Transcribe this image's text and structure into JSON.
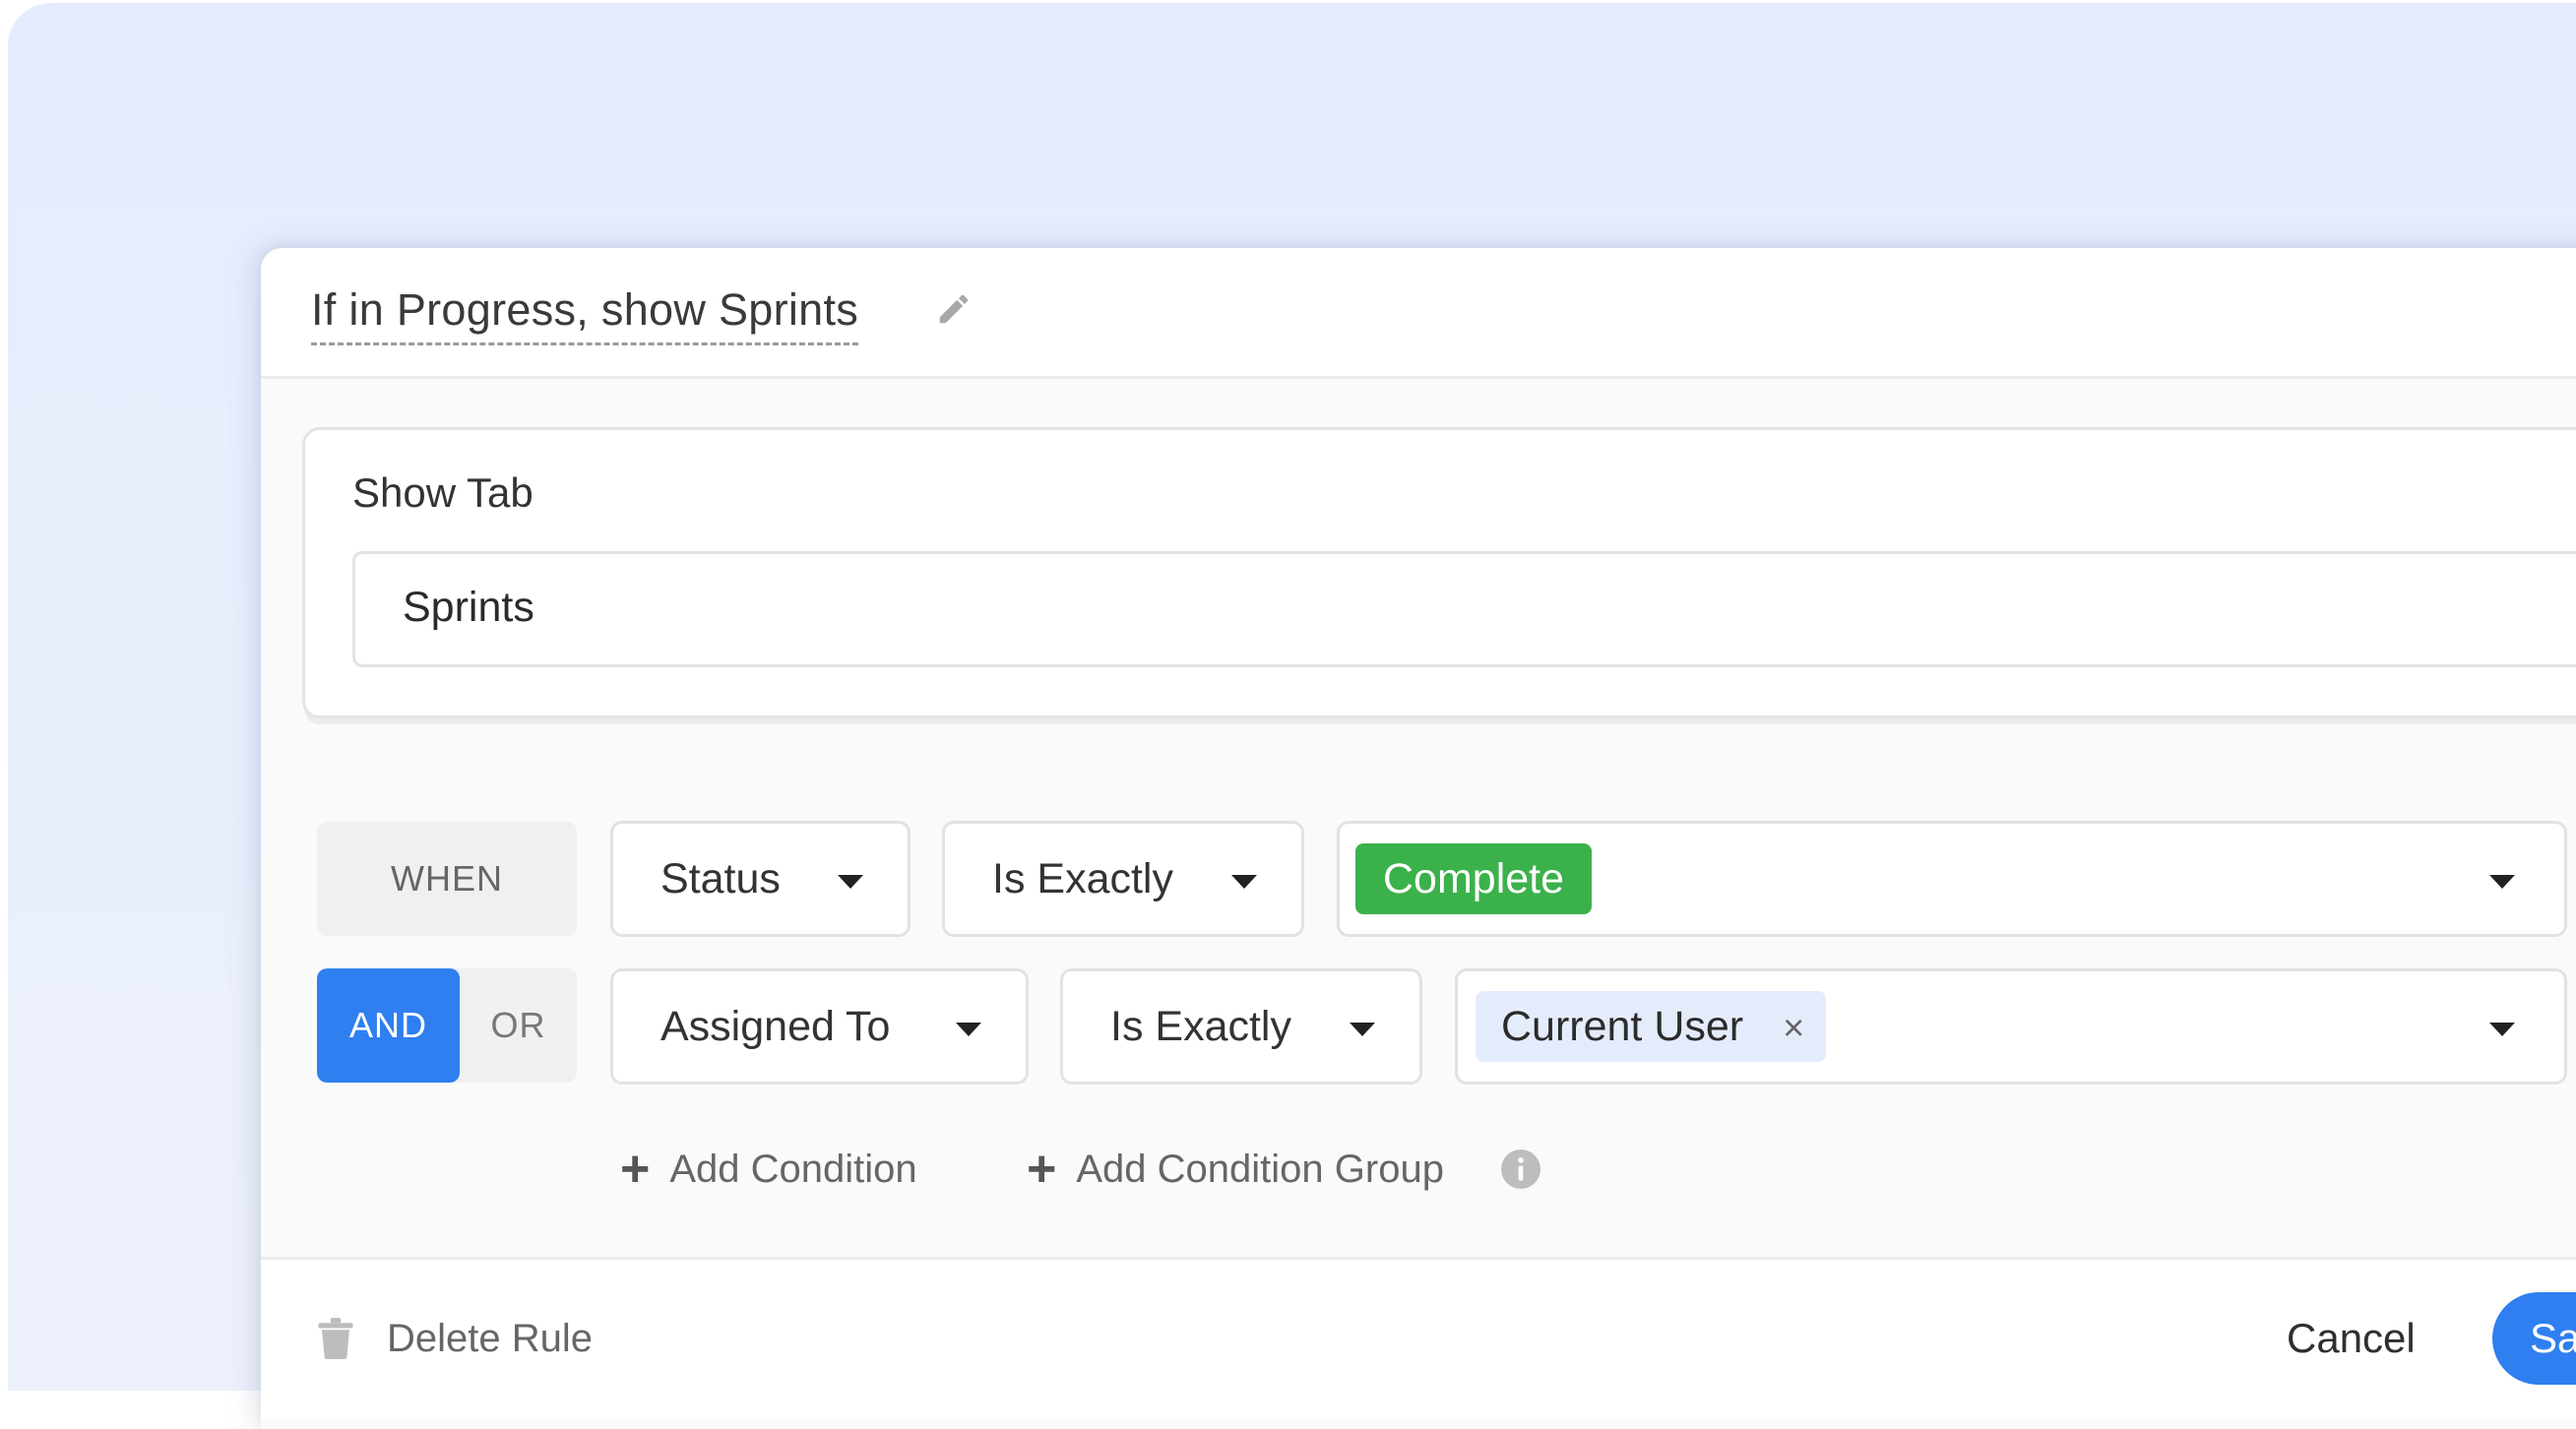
{
  "rule": {
    "title": "If in Progress, show Sprints"
  },
  "show_tab": {
    "label": "Show Tab",
    "selected": "Sprints"
  },
  "conditions": [
    {
      "connector": "WHEN",
      "field": "Status",
      "operator": "Is Exactly",
      "value": "Complete",
      "value_color": "#3bb14b"
    },
    {
      "connector_options": [
        "AND",
        "OR"
      ],
      "connector_selected": "AND",
      "field": "Assigned To",
      "operator": "Is Exactly",
      "value": "Current User",
      "remove_symbol": "×"
    }
  ],
  "actions": {
    "add_condition": "Add Condition",
    "add_condition_group": "Add Condition Group"
  },
  "footer": {
    "delete_label": "Delete Rule",
    "cancel_label": "Cancel",
    "save_label": "Save"
  },
  "colors": {
    "accent": "#2f7ff0",
    "tag_green": "#3bb14b",
    "tag_blue_bg": "#e4ecfb"
  },
  "icons": {
    "title_edit": "pencil-icon",
    "info": "info-icon",
    "delete": "trash-icon"
  }
}
